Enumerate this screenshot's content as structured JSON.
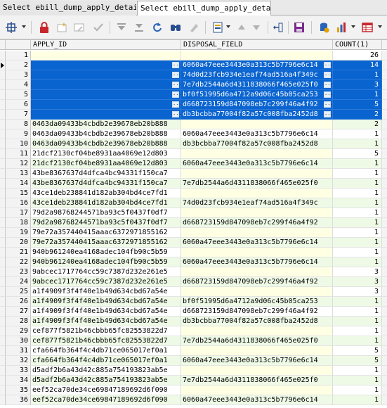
{
  "tabs": [
    {
      "label": "Select ebill_dump_apply_detail"
    },
    {
      "label": "Select ebill_dump_apply_detail"
    }
  ],
  "toolbar": {
    "icons": [
      "grid-options-icon",
      "lock-icon",
      "add-row-icon",
      "delete-row-icon",
      "post-icon",
      "first-record-icon",
      "last-record-icon",
      "refresh-icon",
      "find-icon",
      "clear-icon",
      "single-record-view-icon",
      "sort-ascending-icon",
      "sort-descending-icon",
      "filter-icon",
      "save-icon",
      "export-icon",
      "chart-icon",
      "table-icon"
    ]
  },
  "grid": {
    "columns": [
      "APPLY_ID",
      "DISPOSAL_FIELD",
      "COUNT(1)"
    ],
    "selected_rows": [
      2,
      3,
      4,
      5,
      6,
      7
    ],
    "current_row": 2,
    "ellipsis_label": "...",
    "rows": [
      {
        "n": "1",
        "id": "",
        "dp": "",
        "ct": "26"
      },
      {
        "n": "2",
        "id": "",
        "dp": "6060a47eee3443e0a313c5b7796e6c14",
        "ct": "14"
      },
      {
        "n": "3",
        "id": "",
        "dp": "74d0d23fcb934e1eaf74ad516a4f349c",
        "ct": "1"
      },
      {
        "n": "4",
        "id": "",
        "dp": "7e7db2544a6d4311838066f465e025f0",
        "ct": "3"
      },
      {
        "n": "5",
        "id": "",
        "dp": "bf0f51995d6a4712a9d06c45b05ca253",
        "ct": "1"
      },
      {
        "n": "6",
        "id": "",
        "dp": "d668723159d847098eb7c299f46a4f92",
        "ct": "5"
      },
      {
        "n": "7",
        "id": "",
        "dp": "db3bcbba77004f82a57c008fba2452d8",
        "ct": "2"
      },
      {
        "n": "8",
        "id": "0463da09433b4cbdb2e39678eb20b888",
        "dp": "",
        "ct": "2"
      },
      {
        "n": "9",
        "id": "0463da09433b4cbdb2e39678eb20b888",
        "dp": "6060a47eee3443e0a313c5b7796e6c14",
        "ct": "1"
      },
      {
        "n": "10",
        "id": "0463da09433b4cbdb2e39678eb20b888",
        "dp": "db3bcbba77004f82a57c008fba2452d8",
        "ct": "1"
      },
      {
        "n": "11",
        "id": "21dcf2130cf04be8931aa4069e12d803",
        "dp": "",
        "ct": "5"
      },
      {
        "n": "12",
        "id": "21dcf2130cf04be8931aa4069e12d803",
        "dp": "6060a47eee3443e0a313c5b7796e6c14",
        "ct": "1"
      },
      {
        "n": "13",
        "id": "43be8367637d4dfca4bc94331f150ca7",
        "dp": "",
        "ct": "1"
      },
      {
        "n": "14",
        "id": "43be8367637d4dfca4bc94331f150ca7",
        "dp": "7e7db2544a6d4311838066f465e025f0",
        "ct": "1"
      },
      {
        "n": "15",
        "id": "43ce1deb238841d182ab304bd4ce7fd1",
        "dp": "",
        "ct": "1"
      },
      {
        "n": "16",
        "id": "43ce1deb238841d182ab304bd4ce7fd1",
        "dp": "74d0d23fcb934e1eaf74ad516a4f349c",
        "ct": "1"
      },
      {
        "n": "17",
        "id": "79d2a98768244571ba93c5f0437f0df7",
        "dp": "",
        "ct": "1"
      },
      {
        "n": "18",
        "id": "79d2a98768244571ba93c5f0437f0df7",
        "dp": "d668723159d847098eb7c299f46a4f92",
        "ct": "1"
      },
      {
        "n": "19",
        "id": "79e72a357440415aaac6372971855162",
        "dp": "",
        "ct": "1"
      },
      {
        "n": "20",
        "id": "79e72a357440415aaac6372971855162",
        "dp": "6060a47eee3443e0a313c5b7796e6c14",
        "ct": "1"
      },
      {
        "n": "21",
        "id": "940b961240ea4168adec104fb90c5b59",
        "dp": "",
        "ct": "1"
      },
      {
        "n": "22",
        "id": "940b961240ea4168adec104fb90c5b59",
        "dp": "6060a47eee3443e0a313c5b7796e6c14",
        "ct": "1"
      },
      {
        "n": "23",
        "id": "9abcec1717764cc59c7387d232e261e5",
        "dp": "",
        "ct": "3"
      },
      {
        "n": "24",
        "id": "9abcec1717764cc59c7387d232e261e5",
        "dp": "d668723159d847098eb7c299f46a4f92",
        "ct": "3"
      },
      {
        "n": "25",
        "id": "a1f4909f3f4f40e1b49d634cbd67a54e",
        "dp": "",
        "ct": "3"
      },
      {
        "n": "26",
        "id": "a1f4909f3f4f40e1b49d634cbd67a54e",
        "dp": "bf0f51995d6a4712a9d06c45b05ca253",
        "ct": "1"
      },
      {
        "n": "27",
        "id": "a1f4909f3f4f40e1b49d634cbd67a54e",
        "dp": "d668723159d847098eb7c299f46a4f92",
        "ct": "1"
      },
      {
        "n": "28",
        "id": "a1f4909f3f4f40e1b49d634cbd67a54e",
        "dp": "db3bcbba77004f82a57c008fba2452d8",
        "ct": "1"
      },
      {
        "n": "29",
        "id": "cef877f5821b46cbbb65fc82553822d7",
        "dp": "",
        "ct": "1"
      },
      {
        "n": "30",
        "id": "cef877f5821b46cbbb65fc82553822d7",
        "dp": "7e7db2544a6d4311838066f465e025f0",
        "ct": "1"
      },
      {
        "n": "31",
        "id": "cfa664fb364f4c4db71ce065017ef0a1",
        "dp": "",
        "ct": "5"
      },
      {
        "n": "32",
        "id": "cfa664fb364f4c4db71ce065017ef0a1",
        "dp": "6060a47eee3443e0a313c5b7796e6c14",
        "ct": "5"
      },
      {
        "n": "33",
        "id": "d5adf2b6a43d42c885a754193823ab5e",
        "dp": "",
        "ct": "1"
      },
      {
        "n": "34",
        "id": "d5adf2b6a43d42c885a754193823ab5e",
        "dp": "7e7db2544a6d4311838066f465e025f0",
        "ct": "1"
      },
      {
        "n": "35",
        "id": "eef52ca70de34ce69847189692d6f090",
        "dp": "",
        "ct": "1"
      },
      {
        "n": "36",
        "id": "eef52ca70de34ce69847189692d6f090",
        "dp": "6060a47eee3443e0a313c5b7796e6c14",
        "ct": "1"
      }
    ]
  }
}
